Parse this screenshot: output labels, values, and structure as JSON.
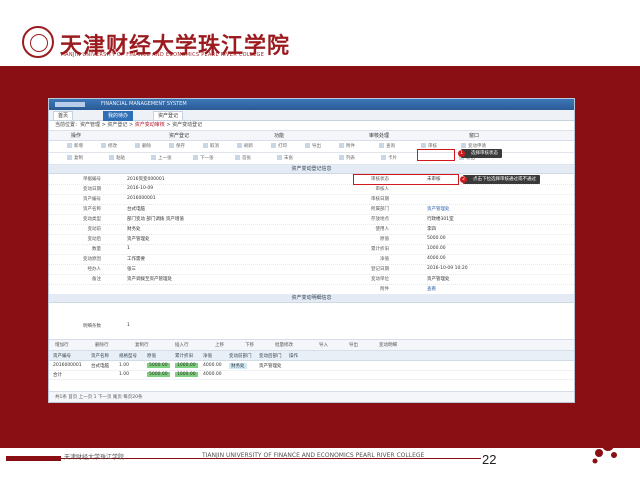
{
  "slide": {
    "school_cn": "天津财经大学珠江学院",
    "school_en": "TIANJIN UNIVERSITY OF FINANCE AND ECONOMICS PEARL RIVER COLLEGE",
    "footer_cn": "天津财经大学珠江学院",
    "footer_en": "TIANJIN UNIVERSITY OF FINANCE AND ECONOMICS PEARL RIVER COLLEGE",
    "page_number": "22",
    "accent": "#8a0f14"
  },
  "app": {
    "title": "FINANCIAL MANAGEMENT SYSTEM",
    "tabs": [
      "首页",
      "我的待办",
      "资产登记",
      ""
    ],
    "breadcrumb_prefix": "当前位置：资产管理 > 资产登记 > ",
    "breadcrumb_highlight": "资产变动审核",
    "breadcrumb_suffix": " > 资产变动登记",
    "menu": [
      "操作",
      "资产登记",
      "功能",
      "审核处理",
      "窗口"
    ],
    "toolbar": [
      "新增",
      "修改",
      "删除",
      "保存",
      "取消",
      "刷新",
      "打印",
      "导出",
      "附件",
      "查询",
      "审核",
      "变动申请"
    ],
    "toolbar2": [
      "复制",
      "粘贴",
      "上一张",
      "下一张",
      "首张",
      "末张",
      "列表",
      "卡片",
      "退出"
    ],
    "section_title": "资产变动登记信息",
    "form_left": [
      {
        "label": "单据编号",
        "value": "2016资变000001"
      },
      {
        "label": "变动日期",
        "value": "2016-10-09"
      },
      {
        "label": "资产编号",
        "value": "2016000001"
      },
      {
        "label": "资产名称",
        "value": "台式电脑"
      },
      {
        "label": "变动类型",
        "value": "部门变动  部门调拨  资产增值"
      },
      {
        "label": "变动前",
        "value": "财务处"
      },
      {
        "label": "变动后",
        "value": "资产管理处"
      },
      {
        "label": "数量",
        "value": "1"
      },
      {
        "label": "变动原因",
        "value": "工作需要"
      },
      {
        "label": "经办人",
        "value": "张三"
      },
      {
        "label": "备注",
        "value": "资产调拨至资产管理处"
      }
    ],
    "form_right": [
      {
        "label": "审核状态",
        "value": "未审核"
      },
      {
        "label": "审核人",
        "value": ""
      },
      {
        "label": "审核日期",
        "value": ""
      },
      {
        "label": "所属部门",
        "value": "资产管理处"
      },
      {
        "label": "存放地点",
        "value": "行政楼301室"
      },
      {
        "label": "使用人",
        "value": "李四"
      },
      {
        "label": "原值",
        "value": "5000.00"
      },
      {
        "label": "累计折旧",
        "value": "1000.00"
      },
      {
        "label": "净值",
        "value": "4000.00"
      },
      {
        "label": "登记日期",
        "value": "2016-10-09 10:20"
      },
      {
        "label": "变动单位",
        "value": "资产管理处"
      },
      {
        "label": "附件",
        "value": "查看"
      }
    ],
    "section2_title": "资产变动明细信息",
    "detail_label": "明细条数",
    "detail_value": "1",
    "callout1": "选择审核状态",
    "callout2": "点击下拉选择审核通过或不通过",
    "grid_toolbar": [
      "增加行",
      "删除行",
      "复制行",
      "插入行",
      "上移",
      "下移",
      "批量修改",
      "导入",
      "导出",
      "变动明细"
    ],
    "grid_headers": [
      "资产编号",
      "资产名称",
      "规格型号",
      "原值",
      "累计折旧",
      "净值",
      "变动前部门",
      "变动后部门",
      "操作"
    ],
    "grid_rows": [
      [
        "2016000001",
        "台式电脑",
        "1.00",
        "5000.00",
        "1000.00",
        "4000.00",
        "财务处",
        "资产管理处",
        ""
      ],
      [
        "合计",
        "",
        "1.00",
        "5000.00",
        "1000.00",
        "4000.00",
        "",
        "",
        ""
      ]
    ],
    "pager_text": "共1条  首页  上一页  1  下一页  尾页  每页20条"
  }
}
